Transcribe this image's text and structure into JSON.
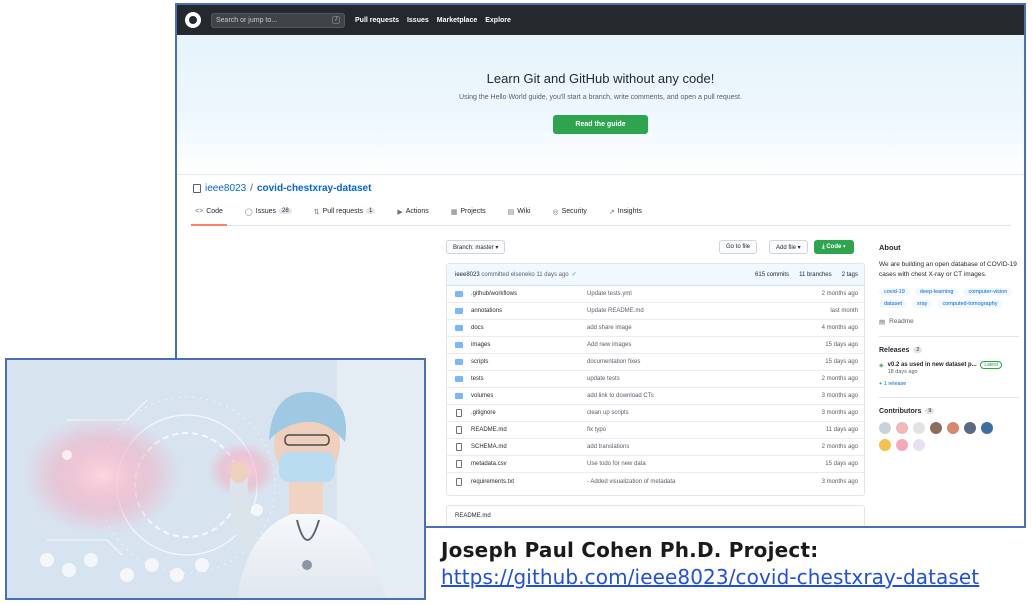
{
  "github": {
    "search_placeholder": "Search or jump to...",
    "search_hotkey": "/",
    "nav": [
      "Pull requests",
      "Issues",
      "Marketplace",
      "Explore"
    ],
    "hero": {
      "title": "Learn Git and GitHub without any code!",
      "subtitle": "Using the Hello World guide, you'll start a branch, write comments, and open a pull request.",
      "button": "Read the guide"
    },
    "repo": {
      "owner": "ieee8023",
      "separator": "/",
      "name": "covid-chestxray-dataset"
    },
    "tabs": [
      {
        "icon": "<>",
        "label": "Code"
      },
      {
        "icon": "◯",
        "label": "Issues",
        "count": "28"
      },
      {
        "icon": "⇅",
        "label": "Pull requests",
        "count": "1"
      },
      {
        "icon": "▶",
        "label": "Actions"
      },
      {
        "icon": "▦",
        "label": "Projects"
      },
      {
        "icon": "▤",
        "label": "Wiki"
      },
      {
        "icon": "◎",
        "label": "Security"
      },
      {
        "icon": "↗",
        "label": "Insights"
      }
    ],
    "controls": {
      "branch": "Branch: master ▾",
      "goto": "Go to file",
      "addfile": "Add file ▾",
      "code": "⤓ Code ▾"
    },
    "commit": {
      "author": "ieee8023",
      "text": "committed elseneko 11 days ago",
      "check": "✓",
      "commits": "615 commits",
      "branches": "11 branches",
      "tags": "2 tags"
    },
    "files": [
      {
        "type": "folder",
        "name": ".github/workflows",
        "msg": "Update tests.yml",
        "age": "2 months ago"
      },
      {
        "type": "folder",
        "name": "annotations",
        "msg": "Update README.md",
        "age": "last month"
      },
      {
        "type": "folder",
        "name": "docs",
        "msg": "add share image",
        "age": "4 months ago"
      },
      {
        "type": "folder",
        "name": "images",
        "msg": "Add new images",
        "age": "15 days ago"
      },
      {
        "type": "folder",
        "name": "scripts",
        "msg": "documentation fixes",
        "age": "15 days ago"
      },
      {
        "type": "folder",
        "name": "tests",
        "msg": "update tests",
        "age": "2 months ago"
      },
      {
        "type": "folder",
        "name": "volumes",
        "msg": "add link to download CTs",
        "age": "3 months ago"
      },
      {
        "type": "file",
        "name": ".gitignore",
        "msg": "clean up scripts",
        "age": "3 months ago"
      },
      {
        "type": "file",
        "name": "README.md",
        "msg": "fix typo",
        "age": "11 days ago"
      },
      {
        "type": "file",
        "name": "SCHEMA.md",
        "msg": "add translations",
        "age": "2 months ago"
      },
      {
        "type": "file",
        "name": "metadata.csv",
        "msg": "Use todo for new data",
        "age": "15 days ago"
      },
      {
        "type": "file",
        "name": "requirements.txt",
        "msg": "- Added visualization of metadata",
        "age": "3 months ago"
      }
    ],
    "readme_header": "README.md",
    "about": {
      "title": "About",
      "description": "We are building an open database of COVID-19 cases with chest X-ray or CT images.",
      "topics": [
        "covid-19",
        "deep-learning",
        "computer-vision",
        "dataset",
        "xray",
        "computed-tomography"
      ],
      "readme": "Readme"
    },
    "releases": {
      "title": "Releases",
      "count": "2",
      "name": "v0.2 as used in new dataset p...",
      "badge": "Latest",
      "date": "18 days ago",
      "more": "+ 1 release"
    },
    "contributors": {
      "title": "Contributors",
      "count": "9",
      "avatar_colors": [
        "#c9d1d9",
        "#f4b7b7",
        "#e3e3e3",
        "#8a6d5c",
        "#d48a6a",
        "#5a6b7d",
        "#3c6e9f",
        "#f2c14e",
        "#f7a8b8",
        "#e8e0f0"
      ]
    }
  },
  "caption": {
    "title": "Joseph Paul Cohen Ph.D. Project:",
    "link": "https://github.com/ieee8023/covid-chestxray-dataset"
  }
}
